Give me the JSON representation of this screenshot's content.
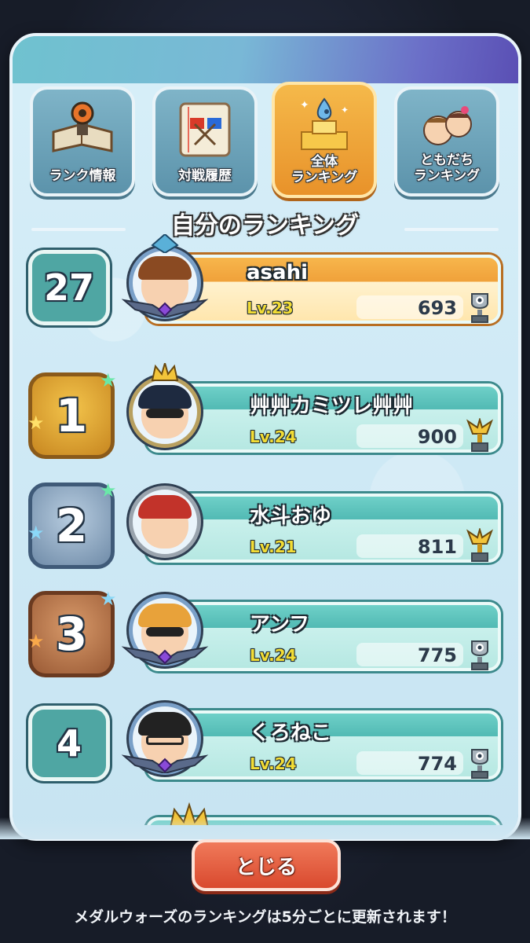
{
  "tabs": [
    {
      "label": "ランク情報",
      "icon": "rank-info-icon",
      "active": false
    },
    {
      "label": "対戦履歴",
      "icon": "battle-history-icon",
      "active": false
    },
    {
      "label": "全体\nランキング",
      "icon": "overall-ranking-icon",
      "active": true
    },
    {
      "label": "ともだち\nランキング",
      "icon": "friends-ranking-icon",
      "active": false
    }
  ],
  "section_title": "自分のランキング",
  "my_rank": {
    "rank": "27",
    "name": "asahi",
    "level": "Lv.23",
    "score": "693"
  },
  "rankings": [
    {
      "rank": "1",
      "name": "艸艸カミツレ艸艸",
      "level": "Lv.24",
      "score": "900",
      "medal": "gold"
    },
    {
      "rank": "2",
      "name": "水斗おゆ",
      "level": "Lv.21",
      "score": "811",
      "medal": "silver"
    },
    {
      "rank": "3",
      "name": "アンフ",
      "level": "Lv.24",
      "score": "775",
      "medal": "bronze"
    },
    {
      "rank": "4",
      "name": "くろねこ",
      "level": "Lv.24",
      "score": "774",
      "medal": "none"
    }
  ],
  "close_button": "とじる",
  "footer_note": "メダルウォーズのランキングは5分ごとに更新されます！",
  "colors": {
    "header": "#6b6fc8",
    "active_tab": "#f0a13a",
    "row_card": "#52bab4",
    "my_card": "#f0a13a",
    "close_button": "#d9492e",
    "level_text": "#f2dc35"
  }
}
